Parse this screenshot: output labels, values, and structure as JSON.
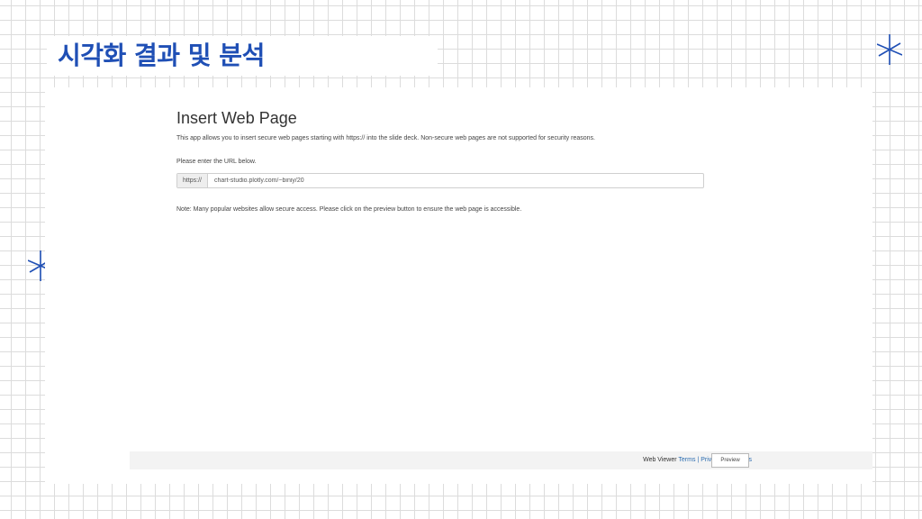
{
  "slide": {
    "title": "시각화 결과 및 분석",
    "accent_color": "#1f4fb5",
    "decorations": [
      "sparkle-icon",
      "sparkle-icon"
    ]
  },
  "web_page": {
    "title": "Insert Web Page",
    "description": "This app allows you to insert secure web pages starting with https:// into the slide deck. Non-secure web pages are not supported for security reasons.",
    "url_label": "Please enter the URL below.",
    "url_prefix": "https://",
    "url_value": "chart-studio.plotly.com/~biniy/20",
    "note": "Note: Many popular websites allow secure access. Please click on the preview button to ensure the web page is accessible."
  },
  "footer": {
    "app_name": "Web Viewer",
    "terms_link": "Terms",
    "separator": "|",
    "privacy_link": "Privacy & Cookies",
    "preview_button": "Preview"
  }
}
